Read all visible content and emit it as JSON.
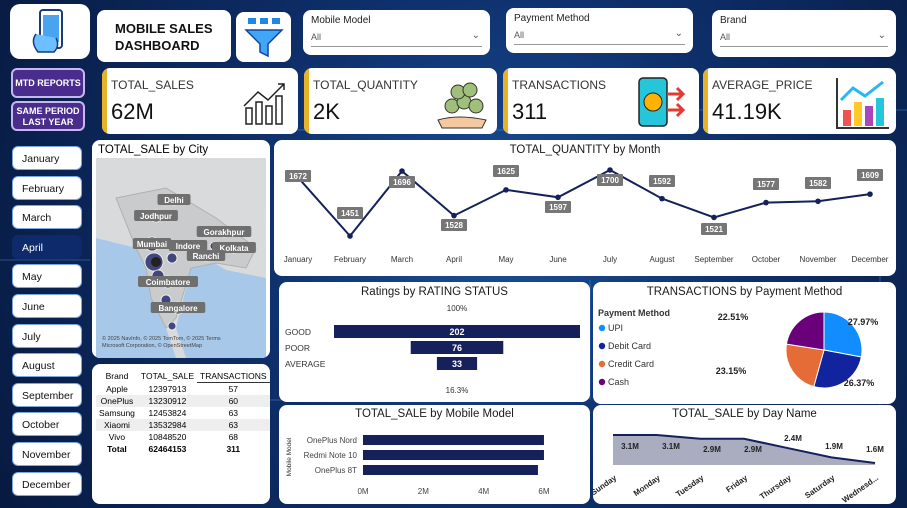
{
  "header": {
    "title_line1": "MOBILE SALES",
    "title_line2": "DASHBOARD"
  },
  "filters": [
    {
      "label": "Mobile Model",
      "value": "All"
    },
    {
      "label": "Payment Method",
      "value": "All"
    },
    {
      "label": "Brand",
      "value": "All"
    }
  ],
  "nav": {
    "mtd": "MTD REPORTS",
    "sply_line1": "SAME PERIOD",
    "sply_line2": "LAST YEAR"
  },
  "kpis": [
    {
      "label": "TOTAL_SALES",
      "value": "62M"
    },
    {
      "label": "TOTAL_QUANTITY",
      "value": "2K"
    },
    {
      "label": "TRANSACTIONS",
      "value": "311"
    },
    {
      "label": "AVERAGE_PRICE",
      "value": "41.19K"
    }
  ],
  "months": {
    "items": [
      "January",
      "February",
      "March",
      "April",
      "May",
      "June",
      "July",
      "August",
      "September",
      "October",
      "November",
      "December"
    ],
    "selected": "April"
  },
  "map": {
    "title": "TOTAL_SALE by City",
    "cities": [
      "Delhi",
      "Jodhpur",
      "Gorakhpur",
      "Mumbai",
      "Indore",
      "Kolkata",
      "Ranchi",
      "Coimbatore",
      "Bangalore"
    ],
    "attr1": "© 2025 NavInfo, © 2025 TomTom, © 2025 Terms",
    "attr2": "Microsoft Corporation, © OpenStreetMap"
  },
  "brand_table": {
    "headers": [
      "Brand",
      "TOTAL_SALE",
      "TRANSACTIONS"
    ],
    "rows": [
      [
        "Apple",
        "12397913",
        "57"
      ],
      [
        "OnePlus",
        "13230912",
        "60"
      ],
      [
        "Samsung",
        "12453824",
        "63"
      ],
      [
        "Xiaomi",
        "13532984",
        "63"
      ],
      [
        "Vivo",
        "10848520",
        "68"
      ]
    ],
    "total": [
      "Total",
      "62464153",
      "311"
    ]
  },
  "charts": {
    "quantity": {
      "title": "TOTAL_QUANTITY by Month"
    },
    "ratings": {
      "title": "Ratings by RATING STATUS",
      "top_pct": "100%",
      "bottom_pct": "16.3%"
    },
    "payment": {
      "title": "TRANSACTIONS by Payment Method",
      "legend_title": "Payment Method"
    },
    "model": {
      "title": "TOTAL_SALE by Mobile Model",
      "ylabel": "Mobile Model"
    },
    "day": {
      "title": "TOTAL_SALE by Day Name"
    }
  },
  "chart_data": [
    {
      "type": "line",
      "title": "TOTAL_QUANTITY by Month",
      "x": [
        "January",
        "February",
        "March",
        "April",
        "May",
        "June",
        "July",
        "August",
        "September",
        "October",
        "November",
        "December"
      ],
      "values": [
        1672,
        1451,
        1696,
        1528,
        1625,
        1597,
        1700,
        1592,
        1521,
        1577,
        1582,
        1609
      ],
      "color": "#16205a"
    },
    {
      "type": "bar",
      "title": "Ratings by RATING STATUS",
      "categories": [
        "GOOD",
        "POOR",
        "AVERAGE"
      ],
      "values": [
        202,
        76,
        33
      ],
      "color": "#16205a"
    },
    {
      "type": "pie",
      "title": "TRANSACTIONS by Payment Method",
      "categories": [
        "UPI",
        "Debit Card",
        "Credit Card",
        "Cash"
      ],
      "values": [
        27.97,
        26.37,
        23.15,
        22.51
      ],
      "labels": [
        "27.97%",
        "26.37%",
        "23.15%",
        "22.51%"
      ],
      "colors": [
        "#118dff",
        "#12239e",
        "#e66c37",
        "#6b007b"
      ]
    },
    {
      "type": "bar",
      "title": "TOTAL_SALE by Mobile Model",
      "categories": [
        "OnePlus Nord",
        "Redmi Note 10",
        "OnePlus 8T"
      ],
      "values": [
        6.0,
        6.0,
        5.8
      ],
      "ticks": [
        "0M",
        "2M",
        "4M",
        "6M"
      ],
      "xlim": [
        0,
        6.2
      ],
      "color": "#16205a"
    },
    {
      "type": "area",
      "title": "TOTAL_SALE by Day Name",
      "x": [
        "Sunday",
        "Monday",
        "Tuesday",
        "Friday",
        "Thursday",
        "Saturday",
        "Wednesd..."
      ],
      "values": [
        3.1,
        3.1,
        2.9,
        2.9,
        2.4,
        1.9,
        1.6
      ],
      "labels": [
        "3.1M",
        "3.1M",
        "2.9M",
        "2.9M",
        "2.4M",
        "1.9M",
        "1.6M"
      ],
      "color": "#16205a"
    }
  ]
}
